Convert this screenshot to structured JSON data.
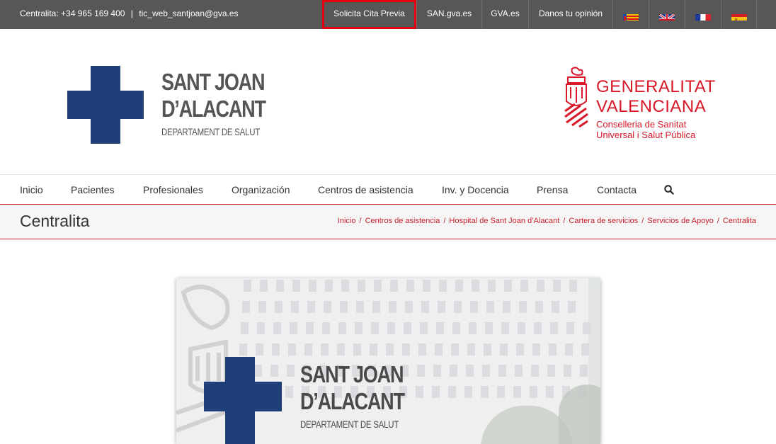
{
  "topbar": {
    "contact_phone": "Centralita: +34 965 169 400",
    "contact_sep": "|",
    "contact_email": "tic_web_santjoan@gva.es",
    "links": {
      "cita_previa": "Solicita Cita Previa",
      "san_gva": "SAN.gva.es",
      "gva": "GVA.es",
      "opinion": "Danos tu opinión"
    },
    "flags": [
      "valenciano-flag-icon",
      "uk-flag-icon",
      "france-flag-icon",
      "spain-flag-icon"
    ],
    "highlight_color": "#e3000f",
    "bg_color": "#575757"
  },
  "header": {
    "logo_left": {
      "line1": "SANT JOAN",
      "line2": "D’ALACANT",
      "line3": "DEPARTAMENT DE SALUT"
    },
    "logo_right": {
      "line1": "GENERALITAT",
      "line2": "VALENCIANA",
      "line3": "Conselleria de Sanitat",
      "line4": "Universal i Salut Pública"
    }
  },
  "nav": {
    "items": [
      "Inicio",
      "Pacientes",
      "Profesionales",
      "Organización",
      "Centros de asistencia",
      "Inv. y Docencia",
      "Prensa",
      "Contacta"
    ],
    "search_icon": "search-icon"
  },
  "page": {
    "title": "Centralita",
    "breadcrumb": [
      "Inicio",
      "Centros de asistencia",
      "Hospital de Sant Joan d’Alacant",
      "Cartera de servicios",
      "Servicios de Apoyo",
      "Centralita"
    ],
    "breadcrumb_sep": "/",
    "accent_color": "#c9202b"
  },
  "hero": {
    "line1": "SANT JOAN",
    "line2": "D’ALACANT",
    "line3": "DEPARTAMENT DE SALUT"
  }
}
